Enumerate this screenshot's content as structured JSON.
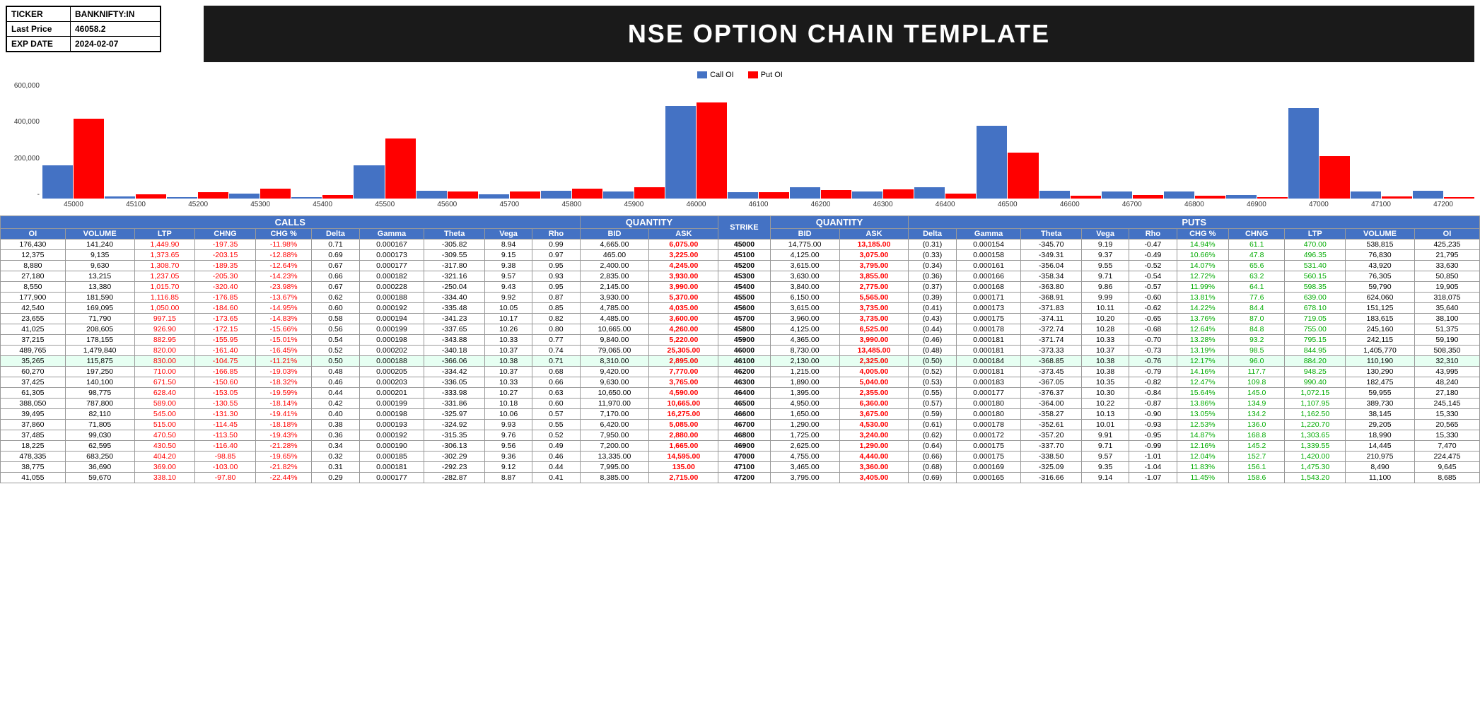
{
  "ticker": {
    "label1": "TICKER",
    "value1": "BANKNIFTY:IN",
    "label2": "Last Price",
    "value2": "46058.2",
    "label3": "EXP DATE",
    "value3": "2024-02-07"
  },
  "title": "NSE OPTION CHAIN TEMPLATE",
  "chart": {
    "legend": [
      "Call OI",
      "Put OI"
    ],
    "yLabels": [
      "600,000",
      "400,000",
      "200,000",
      "-"
    ],
    "xLabels": [
      "45000",
      "45100",
      "45200",
      "45300",
      "45400",
      "45500",
      "45600",
      "45700",
      "45800",
      "45900",
      "46000",
      "46100",
      "46200",
      "46300",
      "46400",
      "46500",
      "46600",
      "46700",
      "46800",
      "46900",
      "47000",
      "47100",
      "47200"
    ],
    "callOI": [
      176430,
      12375,
      8880,
      27180,
      8550,
      177900,
      42540,
      23655,
      41025,
      37215,
      489765,
      35265,
      60270,
      37425,
      61305,
      388050,
      39495,
      37860,
      37485,
      18225,
      478335,
      38775,
      41055
    ],
    "putOI": [
      425235,
      21795,
      33630,
      50850,
      19905,
      318075,
      35640,
      38100,
      51375,
      59190,
      508350,
      32310,
      43995,
      48240,
      27180,
      245145,
      15330,
      20565,
      15330,
      7470,
      224475,
      9645,
      8685
    ]
  },
  "table": {
    "callsHeader": "CALLS",
    "quantityHeader": "QUANTITY",
    "putsHeader": "PUTS",
    "callCols": [
      "OI",
      "VOLUME",
      "LTP",
      "CHNG",
      "CHG %",
      "Delta",
      "Gamma",
      "Theta",
      "Vega",
      "Rho"
    ],
    "quantityCols": [
      "BID",
      "ASK"
    ],
    "strikeCols": [
      "STRIKE"
    ],
    "putCols": [
      "BID",
      "ASK",
      "Delta",
      "Gamma",
      "Theta",
      "Vega",
      "Rho",
      "CHG %",
      "CHNG",
      "LTP",
      "VOLUME",
      "OI"
    ],
    "rows": [
      {
        "strike": 45000,
        "cOI": 176430,
        "cVol": 141240,
        "cLTP": 1449.9,
        "cChng": -197.35,
        "cChngPct": -11.98,
        "cDelta": 0.71,
        "cGamma": 0.000167,
        "cTheta": -305.82,
        "cVega": 8.94,
        "cRho": 0.99,
        "bid": 4665.0,
        "ask": 6075.0,
        "pBid": 14775.0,
        "pAsk": 13185.0,
        "pDelta": -0.31,
        "pGamma": 0.000154,
        "pTheta": -345.7,
        "pVega": 9.19,
        "pRho": -0.47,
        "pChngPct": 14.94,
        "pChng": 61.1,
        "pLTP": 470.0,
        "pVol": 538815,
        "pOI": 425235
      },
      {
        "strike": 45100,
        "cOI": 12375,
        "cVol": 9135,
        "cLTP": 1373.65,
        "cChng": -203.15,
        "cChngPct": -12.88,
        "cDelta": 0.69,
        "cGamma": 0.000173,
        "cTheta": -309.55,
        "cVega": 9.15,
        "cRho": 0.97,
        "bid": 465.0,
        "ask": 3225.0,
        "pBid": 4125.0,
        "pAsk": 3075.0,
        "pDelta": -0.33,
        "pGamma": 0.000158,
        "pTheta": -349.31,
        "pVega": 9.37,
        "pRho": -0.49,
        "pChngPct": 10.66,
        "pChng": 47.8,
        "pLTP": 496.35,
        "pVol": 76830,
        "pOI": 21795
      },
      {
        "strike": 45200,
        "cOI": 8880,
        "cVol": 9630,
        "cLTP": 1308.7,
        "cChng": -189.35,
        "cChngPct": -12.64,
        "cDelta": 0.67,
        "cGamma": 0.000177,
        "cTheta": -317.8,
        "cVega": 9.38,
        "cRho": 0.95,
        "bid": 2400.0,
        "ask": 4245.0,
        "pBid": 3615.0,
        "pAsk": 3795.0,
        "pDelta": -0.34,
        "pGamma": 0.000161,
        "pTheta": -356.04,
        "pVega": 9.55,
        "pRho": -0.52,
        "pChngPct": 14.07,
        "pChng": 65.55,
        "pLTP": 531.4,
        "pVol": 43920,
        "pOI": 33630
      },
      {
        "strike": 45300,
        "cOI": 27180,
        "cVol": 13215,
        "cLTP": 1237.05,
        "cChng": -205.3,
        "cChngPct": -14.23,
        "cDelta": 0.66,
        "cGamma": 0.000182,
        "cTheta": -321.16,
        "cVega": 9.57,
        "cRho": 0.93,
        "bid": 2835.0,
        "ask": 3930.0,
        "pBid": 3630.0,
        "pAsk": 3855.0,
        "pDelta": -0.36,
        "pGamma": 0.000166,
        "pTheta": -358.34,
        "pVega": 9.71,
        "pRho": -0.54,
        "pChngPct": 12.72,
        "pChng": 63.2,
        "pLTP": 560.15,
        "pVol": 76305,
        "pOI": 50850
      },
      {
        "strike": 45400,
        "cOI": 8550,
        "cVol": 13380,
        "cLTP": 1015.7,
        "cChng": -320.4,
        "cChngPct": -23.98,
        "cDelta": 0.67,
        "cGamma": 0.000228,
        "cTheta": -250.04,
        "cVega": 9.43,
        "cRho": 0.95,
        "bid": 2145.0,
        "ask": 3990.0,
        "pBid": 3840.0,
        "pAsk": 2775.0,
        "pDelta": -0.37,
        "pGamma": 0.000168,
        "pTheta": -363.8,
        "pVega": 9.86,
        "pRho": -0.57,
        "pChngPct": 11.99,
        "pChng": 64.05,
        "pLTP": 598.35,
        "pVol": 59790,
        "pOI": 19905
      },
      {
        "strike": 45500,
        "cOI": 177900,
        "cVol": 181590,
        "cLTP": 1116.85,
        "cChng": -176.85,
        "cChngPct": -13.67,
        "cDelta": 0.62,
        "cGamma": 0.000188,
        "cTheta": -334.4,
        "cVega": 9.92,
        "cRho": 0.87,
        "bid": 3930.0,
        "ask": 5370.0,
        "pBid": 6150.0,
        "pAsk": 5565.0,
        "pDelta": -0.39,
        "pGamma": 0.000171,
        "pTheta": -368.91,
        "pVega": 9.99,
        "pRho": -0.6,
        "pChngPct": 13.81,
        "pChng": 77.55,
        "pLTP": 639.0,
        "pVol": 624060,
        "pOI": 318075
      },
      {
        "strike": 45600,
        "cOI": 42540,
        "cVol": 169095,
        "cLTP": 1050.0,
        "cChng": -184.6,
        "cChngPct": -14.95,
        "cDelta": 0.6,
        "cGamma": 0.000192,
        "cTheta": -335.48,
        "cVega": 10.05,
        "cRho": 0.85,
        "bid": 4785.0,
        "ask": 4035.0,
        "pBid": 3615.0,
        "pAsk": 3735.0,
        "pDelta": -0.41,
        "pGamma": 0.000173,
        "pTheta": -371.83,
        "pVega": 10.11,
        "pRho": -0.62,
        "pChngPct": 14.22,
        "pChng": 84.4,
        "pLTP": 678.1,
        "pVol": 151125,
        "pOI": 35640
      },
      {
        "strike": 45700,
        "cOI": 23655,
        "cVol": 71790,
        "cLTP": 997.15,
        "cChng": -173.65,
        "cChngPct": -14.83,
        "cDelta": 0.58,
        "cGamma": 0.000194,
        "cTheta": -341.23,
        "cVega": 10.17,
        "cRho": 0.82,
        "bid": 4485.0,
        "ask": 3600.0,
        "pBid": 3960.0,
        "pAsk": 3735.0,
        "pDelta": -0.43,
        "pGamma": 0.000175,
        "pTheta": -374.11,
        "pVega": 10.2,
        "pRho": -0.65,
        "pChngPct": 13.76,
        "pChng": 86.95,
        "pLTP": 719.05,
        "pVol": 183615,
        "pOI": 38100
      },
      {
        "strike": 45800,
        "cOI": 41025,
        "cVol": 208605,
        "cLTP": 926.9,
        "cChng": -172.15,
        "cChngPct": -15.66,
        "cDelta": 0.56,
        "cGamma": 0.000199,
        "cTheta": -337.65,
        "cVega": 10.26,
        "cRho": 0.8,
        "bid": 10665.0,
        "ask": 4260.0,
        "pBid": 4125.0,
        "pAsk": 6525.0,
        "pDelta": -0.44,
        "pGamma": 0.000178,
        "pTheta": -372.74,
        "pVega": 10.28,
        "pRho": -0.68,
        "pChngPct": 12.64,
        "pChng": 84.75,
        "pLTP": 755.0,
        "pVol": 245160,
        "pOI": 51375
      },
      {
        "strike": 45900,
        "cOI": 37215,
        "cVol": 178155,
        "cLTP": 882.95,
        "cChng": -155.95,
        "cChngPct": -15.01,
        "cDelta": 0.54,
        "cGamma": 0.000198,
        "cTheta": -343.88,
        "cVega": 10.33,
        "cRho": 0.77,
        "bid": 9840.0,
        "ask": 5220.0,
        "pBid": 4365.0,
        "pAsk": 3990.0,
        "pDelta": -0.46,
        "pGamma": 0.000181,
        "pTheta": -371.74,
        "pVega": 10.33,
        "pRho": -0.7,
        "pChngPct": 13.28,
        "pChng": 93.2,
        "pLTP": 795.15,
        "pVol": 242115,
        "pOI": 59190
      },
      {
        "strike": 46000,
        "cOI": 489765,
        "cVol": 1479840,
        "cLTP": 820.0,
        "cChng": -161.4,
        "cChngPct": -16.45,
        "cDelta": 0.52,
        "cGamma": 0.000202,
        "cTheta": -340.18,
        "cVega": 10.37,
        "cRho": 0.74,
        "bid": 79065.0,
        "ask": 25305.0,
        "pBid": 8730.0,
        "pAsk": 13485.0,
        "pDelta": -0.48,
        "pGamma": 0.000181,
        "pTheta": -373.33,
        "pVega": 10.37,
        "pRho": -0.73,
        "pChngPct": 13.19,
        "pChng": 98.45,
        "pLTP": 844.95,
        "pVol": 1405770,
        "pOI": 508350
      },
      {
        "strike": 46100,
        "cOI": 35265,
        "cVol": 115875,
        "cLTP": 830.0,
        "cChng": -104.75,
        "cChngPct": -11.21,
        "cDelta": 0.5,
        "cGamma": 0.000188,
        "cTheta": -366.06,
        "cVega": 10.38,
        "cRho": 0.71,
        "bid": 8310.0,
        "ask": 2895.0,
        "pBid": 2130.0,
        "pAsk": 2325.0,
        "pDelta": -0.5,
        "pGamma": 0.000184,
        "pTheta": -368.85,
        "pVega": 10.38,
        "pRho": -0.76,
        "pChngPct": 12.17,
        "pChng": 95.95,
        "pLTP": 884.2,
        "pVol": 110190,
        "pOI": 32310,
        "atm": true
      },
      {
        "strike": 46200,
        "cOI": 60270,
        "cVol": 197250,
        "cLTP": 710.0,
        "cChng": -166.85,
        "cChngPct": -19.03,
        "cDelta": 0.48,
        "cGamma": 0.000205,
        "cTheta": -334.42,
        "cVega": 10.37,
        "cRho": 0.68,
        "bid": 9420.0,
        "ask": 7770.0,
        "pBid": 1215.0,
        "pAsk": 4005.0,
        "pDelta": -0.52,
        "pGamma": 0.000181,
        "pTheta": -373.45,
        "pVega": 10.38,
        "pRho": -0.79,
        "pChngPct": 14.16,
        "pChng": 117.7,
        "pLTP": 948.25,
        "pVol": 130290,
        "pOI": 43995
      },
      {
        "strike": 46300,
        "cOI": 37425,
        "cVol": 140100,
        "cLTP": 671.5,
        "cChng": -150.6,
        "cChngPct": -18.32,
        "cDelta": 0.46,
        "cGamma": 0.000203,
        "cTheta": -336.05,
        "cVega": 10.33,
        "cRho": 0.66,
        "bid": 9630.0,
        "ask": 3765.0,
        "pBid": 1890.0,
        "pAsk": 5040.0,
        "pDelta": -0.53,
        "pGamma": 0.000183,
        "pTheta": -367.05,
        "pVega": 10.35,
        "pRho": -0.82,
        "pChngPct": 12.47,
        "pChng": 109.8,
        "pLTP": 990.4,
        "pVol": 182475,
        "pOI": 48240
      },
      {
        "strike": 46400,
        "cOI": 61305,
        "cVol": 98775,
        "cLTP": 628.4,
        "cChng": -153.05,
        "cChngPct": -19.59,
        "cDelta": 0.44,
        "cGamma": 0.000201,
        "cTheta": -333.98,
        "cVega": 10.27,
        "cRho": 0.63,
        "bid": 10650.0,
        "ask": 4590.0,
        "pBid": 1395.0,
        "pAsk": 2355.0,
        "pDelta": -0.55,
        "pGamma": 0.000177,
        "pTheta": -376.37,
        "pVega": 10.3,
        "pRho": -0.84,
        "pChngPct": 15.64,
        "pChng": 145,
        "pLTP": 1072.15,
        "pVol": 59955,
        "pOI": 27180
      },
      {
        "strike": 46500,
        "cOI": 388050,
        "cVol": 787800,
        "cLTP": 589.0,
        "cChng": -130.55,
        "cChngPct": -18.14,
        "cDelta": 0.42,
        "cGamma": 0.000199,
        "cTheta": -331.86,
        "cVega": 10.18,
        "cRho": 0.6,
        "bid": 11970.0,
        "ask": 10665.0,
        "pBid": 4950.0,
        "pAsk": 6360.0,
        "pDelta": -0.57,
        "pGamma": 0.00018,
        "pTheta": -364.0,
        "pVega": 10.22,
        "pRho": -0.87,
        "pChngPct": 13.86,
        "pChng": 134.9,
        "pLTP": 1107.95,
        "pVol": 389730,
        "pOI": 245145
      },
      {
        "strike": 46600,
        "cOI": 39495,
        "cVol": 82110,
        "cLTP": 545.0,
        "cChng": -131.3,
        "cChngPct": -19.41,
        "cDelta": 0.4,
        "cGamma": 0.000198,
        "cTheta": -325.97,
        "cVega": 10.06,
        "cRho": 0.57,
        "bid": 7170.0,
        "ask": 16275.0,
        "pBid": 1650.0,
        "pAsk": 3675.0,
        "pDelta": -0.59,
        "pGamma": 0.00018,
        "pTheta": -358.27,
        "pVega": 10.13,
        "pRho": -0.9,
        "pChngPct": 13.05,
        "pChng": 134.2,
        "pLTP": 1162.5,
        "pVol": 38145,
        "pOI": 15330
      },
      {
        "strike": 46700,
        "cOI": 37860,
        "cVol": 71805,
        "cLTP": 515.0,
        "cChng": -114.45,
        "cChngPct": -18.18,
        "cDelta": 0.38,
        "cGamma": 0.000193,
        "cTheta": -324.92,
        "cVega": 9.93,
        "cRho": 0.55,
        "bid": 6420.0,
        "ask": 5085.0,
        "pBid": 1290.0,
        "pAsk": 4530.0,
        "pDelta": -0.61,
        "pGamma": 0.000178,
        "pTheta": -352.61,
        "pVega": 10.01,
        "pRho": -0.93,
        "pChngPct": 12.53,
        "pChng": 136,
        "pLTP": 1220.7,
        "pVol": 29205,
        "pOI": 20565
      },
      {
        "strike": 46800,
        "cOI": 37485,
        "cVol": 99030,
        "cLTP": 470.5,
        "cChng": -113.5,
        "cChngPct": -19.43,
        "cDelta": 0.36,
        "cGamma": 0.000192,
        "cTheta": -315.35,
        "cVega": 9.76,
        "cRho": 0.52,
        "bid": 7950.0,
        "ask": 2880.0,
        "pBid": 1725.0,
        "pAsk": 3240.0,
        "pDelta": -0.62,
        "pGamma": 0.000172,
        "pTheta": -357.2,
        "pVega": 9.91,
        "pRho": -0.95,
        "pChngPct": 14.87,
        "pChng": 168.8,
        "pLTP": 1303.65,
        "pVol": 18990,
        "pOI": 15330
      },
      {
        "strike": 46900,
        "cOI": 18225,
        "cVol": 62595,
        "cLTP": 430.5,
        "cChng": -116.4,
        "cChngPct": -21.28,
        "cDelta": 0.34,
        "cGamma": 0.00019,
        "cTheta": -306.13,
        "cVega": 9.56,
        "cRho": 0.49,
        "bid": 7200.0,
        "ask": 1665.0,
        "pBid": 2625.0,
        "pAsk": 1290.0,
        "pDelta": -0.64,
        "pGamma": 0.000175,
        "pTheta": -337.7,
        "pVega": 9.71,
        "pRho": -0.99,
        "pChngPct": 12.16,
        "pChng": 145.2,
        "pLTP": 1339.55,
        "pVol": 14445,
        "pOI": 7470
      },
      {
        "strike": 47000,
        "cOI": 478335,
        "cVol": 683250,
        "cLTP": 404.2,
        "cChng": -98.85,
        "cChngPct": -19.65,
        "cDelta": 0.32,
        "cGamma": 0.000185,
        "cTheta": -302.29,
        "cVega": 9.36,
        "cRho": 0.46,
        "bid": 13335.0,
        "ask": 14595.0,
        "pBid": 4755.0,
        "pAsk": 4440.0,
        "pDelta": -0.66,
        "pGamma": 0.000175,
        "pTheta": -338.5,
        "pVega": 9.57,
        "pRho": -1.01,
        "pChngPct": 12.04,
        "pChng": 152.7,
        "pLTP": 1420.0,
        "pVol": 210975,
        "pOI": 224475
      },
      {
        "strike": 47100,
        "cOI": 38775,
        "cVol": 36690,
        "cLTP": 369.0,
        "cChng": -103.0,
        "cChngPct": -21.82,
        "cDelta": 0.31,
        "cGamma": 0.000181,
        "cTheta": -292.23,
        "cVega": 9.12,
        "cRho": 0.44,
        "bid": 7995.0,
        "ask": 135.0,
        "pBid": 3465.0,
        "pAsk": 3360.0,
        "pDelta": -0.68,
        "pGamma": 0.000169,
        "pTheta": -325.09,
        "pVega": 9.35,
        "pRho": -1.04,
        "pChngPct": 11.83,
        "pChng": 156.1,
        "pLTP": 1475.3,
        "pVol": 8490,
        "pOI": 9645
      },
      {
        "strike": 47200,
        "cOI": 41055,
        "cVol": 59670,
        "cLTP": 338.1,
        "cChng": -97.8,
        "cChngPct": -22.44,
        "cDelta": 0.29,
        "cGamma": 0.000177,
        "cTheta": -282.87,
        "cVega": 8.87,
        "cRho": 0.41,
        "bid": 8385.0,
        "ask": 2715.0,
        "pBid": 3795.0,
        "pAsk": 3405.0,
        "pDelta": -0.69,
        "pGamma": 0.000165,
        "pTheta": -316.66,
        "pVega": 9.14,
        "pRho": -1.07,
        "pChngPct": 11.45,
        "pChng": 158.6,
        "pLTP": 1543.2,
        "pVol": 11100,
        "pOI": 8685
      }
    ]
  }
}
